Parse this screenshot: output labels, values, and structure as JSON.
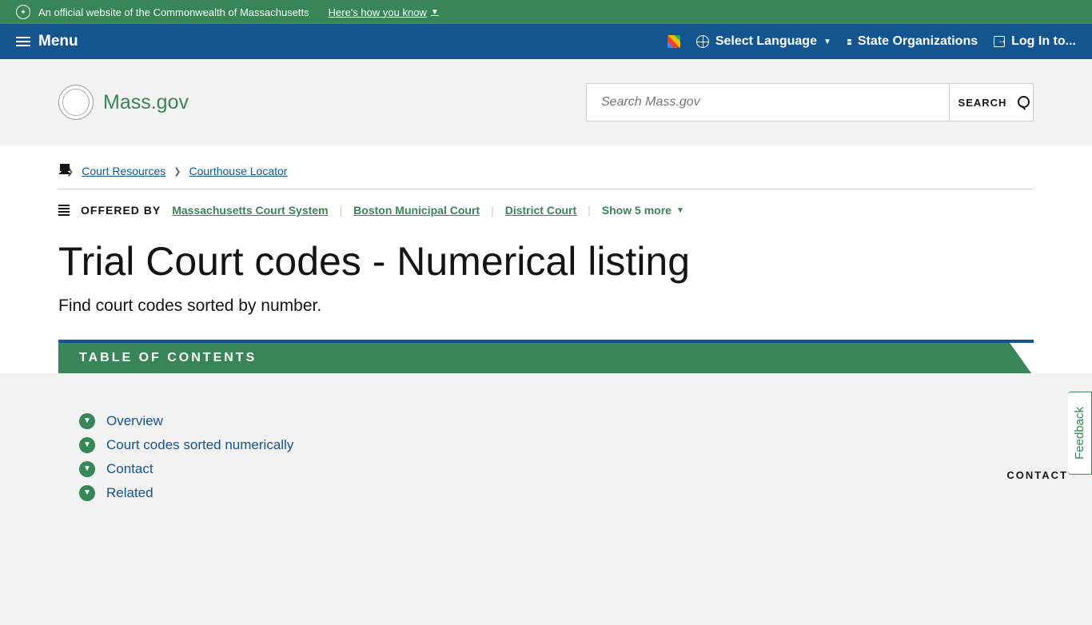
{
  "banner": {
    "text": "An official website of the Commonwealth of Massachusetts",
    "link": "Here's how you know"
  },
  "nav": {
    "menu": "Menu",
    "language": "Select Language",
    "state_orgs": "State Organizations",
    "login": "Log In to..."
  },
  "header": {
    "logo": "Mass.gov",
    "search_placeholder": "Search Mass.gov",
    "search_btn": "SEARCH"
  },
  "breadcrumbs": [
    {
      "label": "Court Resources"
    },
    {
      "label": "Courthouse Locator"
    }
  ],
  "offered": {
    "label": "Offered By",
    "orgs": [
      "Massachusetts Court System",
      "Boston Municipal Court",
      "District Court"
    ],
    "show_more": "Show 5 more"
  },
  "page": {
    "title": "Trial Court codes - Numerical listing",
    "subtitle": "Find court codes sorted by number."
  },
  "toc": {
    "heading": "TABLE OF CONTENTS",
    "items": [
      "Overview",
      "Court codes sorted numerically",
      "Contact",
      "Related"
    ]
  },
  "contact_heading": "CONTACT",
  "feedback": "Feedback"
}
